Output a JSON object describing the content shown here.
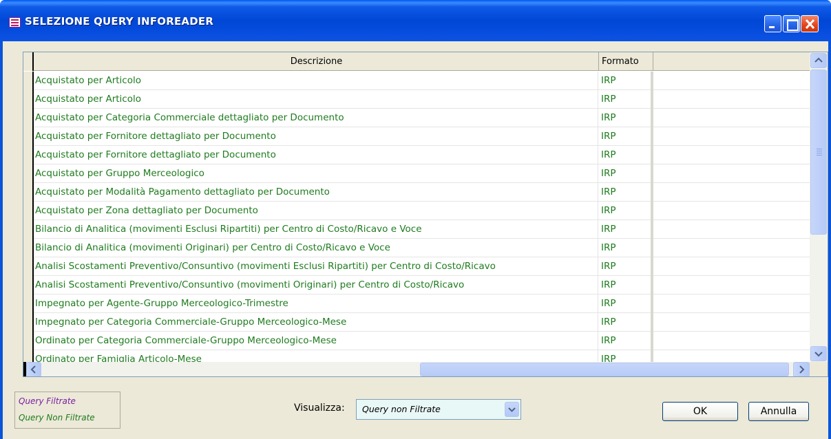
{
  "window": {
    "title": "SELEZIONE QUERY INFOREADER"
  },
  "grid": {
    "columns": [
      "Descrizione",
      "Formato",
      ""
    ],
    "rows": [
      {
        "description": "Acquistato per Articolo",
        "format": "IRP"
      },
      {
        "description": "Acquistato per Articolo",
        "format": "IRP"
      },
      {
        "description": "Acquistato per Categoria Commerciale dettagliato per Documento",
        "format": "IRP"
      },
      {
        "description": "Acquistato per Fornitore dettagliato per Documento",
        "format": "IRP"
      },
      {
        "description": "Acquistato per Fornitore dettagliato per Documento",
        "format": "IRP"
      },
      {
        "description": "Acquistato per Gruppo Merceologico",
        "format": "IRP"
      },
      {
        "description": "Acquistato per Modalità Pagamento dettagliato per Documento",
        "format": "IRP"
      },
      {
        "description": "Acquistato per Zona dettagliato per Documento",
        "format": "IRP"
      },
      {
        "description": "Bilancio di Analitica (movimenti Esclusi Ripartiti) per Centro di Costo/Ricavo e Voce",
        "format": "IRP"
      },
      {
        "description": "Bilancio di Analitica (movimenti Originari) per Centro di Costo/Ricavo e Voce",
        "format": "IRP"
      },
      {
        "description": "Analisi Scostamenti Preventivo/Consuntivo (movimenti Esclusi Ripartiti) per Centro di Costo/Ricavo",
        "format": "IRP"
      },
      {
        "description": "Analisi Scostamenti Preventivo/Consuntivo (movimenti Originari) per Centro di Costo/Ricavo",
        "format": "IRP"
      },
      {
        "description": "Impegnato per Agente-Gruppo Merceologico-Trimestre",
        "format": "IRP"
      },
      {
        "description": "Impegnato per Categoria Commerciale-Gruppo Merceologico-Mese",
        "format": "IRP"
      },
      {
        "description": "Ordinato per Categoria Commerciale-Gruppo Merceologico-Mese",
        "format": "IRP"
      },
      {
        "description": "Ordinato per Famiglia Articolo-Mese",
        "format": "IRP"
      }
    ]
  },
  "legend": {
    "filtered": "Query Filtrate",
    "unfiltered": "Query Non Filtrate"
  },
  "view": {
    "label": "Visualizza:",
    "selected": "Query non Filtrate"
  },
  "buttons": {
    "ok": "OK",
    "cancel": "Annulla"
  },
  "colors": {
    "unfiltered_text": "#1e7b1e",
    "filtered_text": "#7b1fa2"
  }
}
